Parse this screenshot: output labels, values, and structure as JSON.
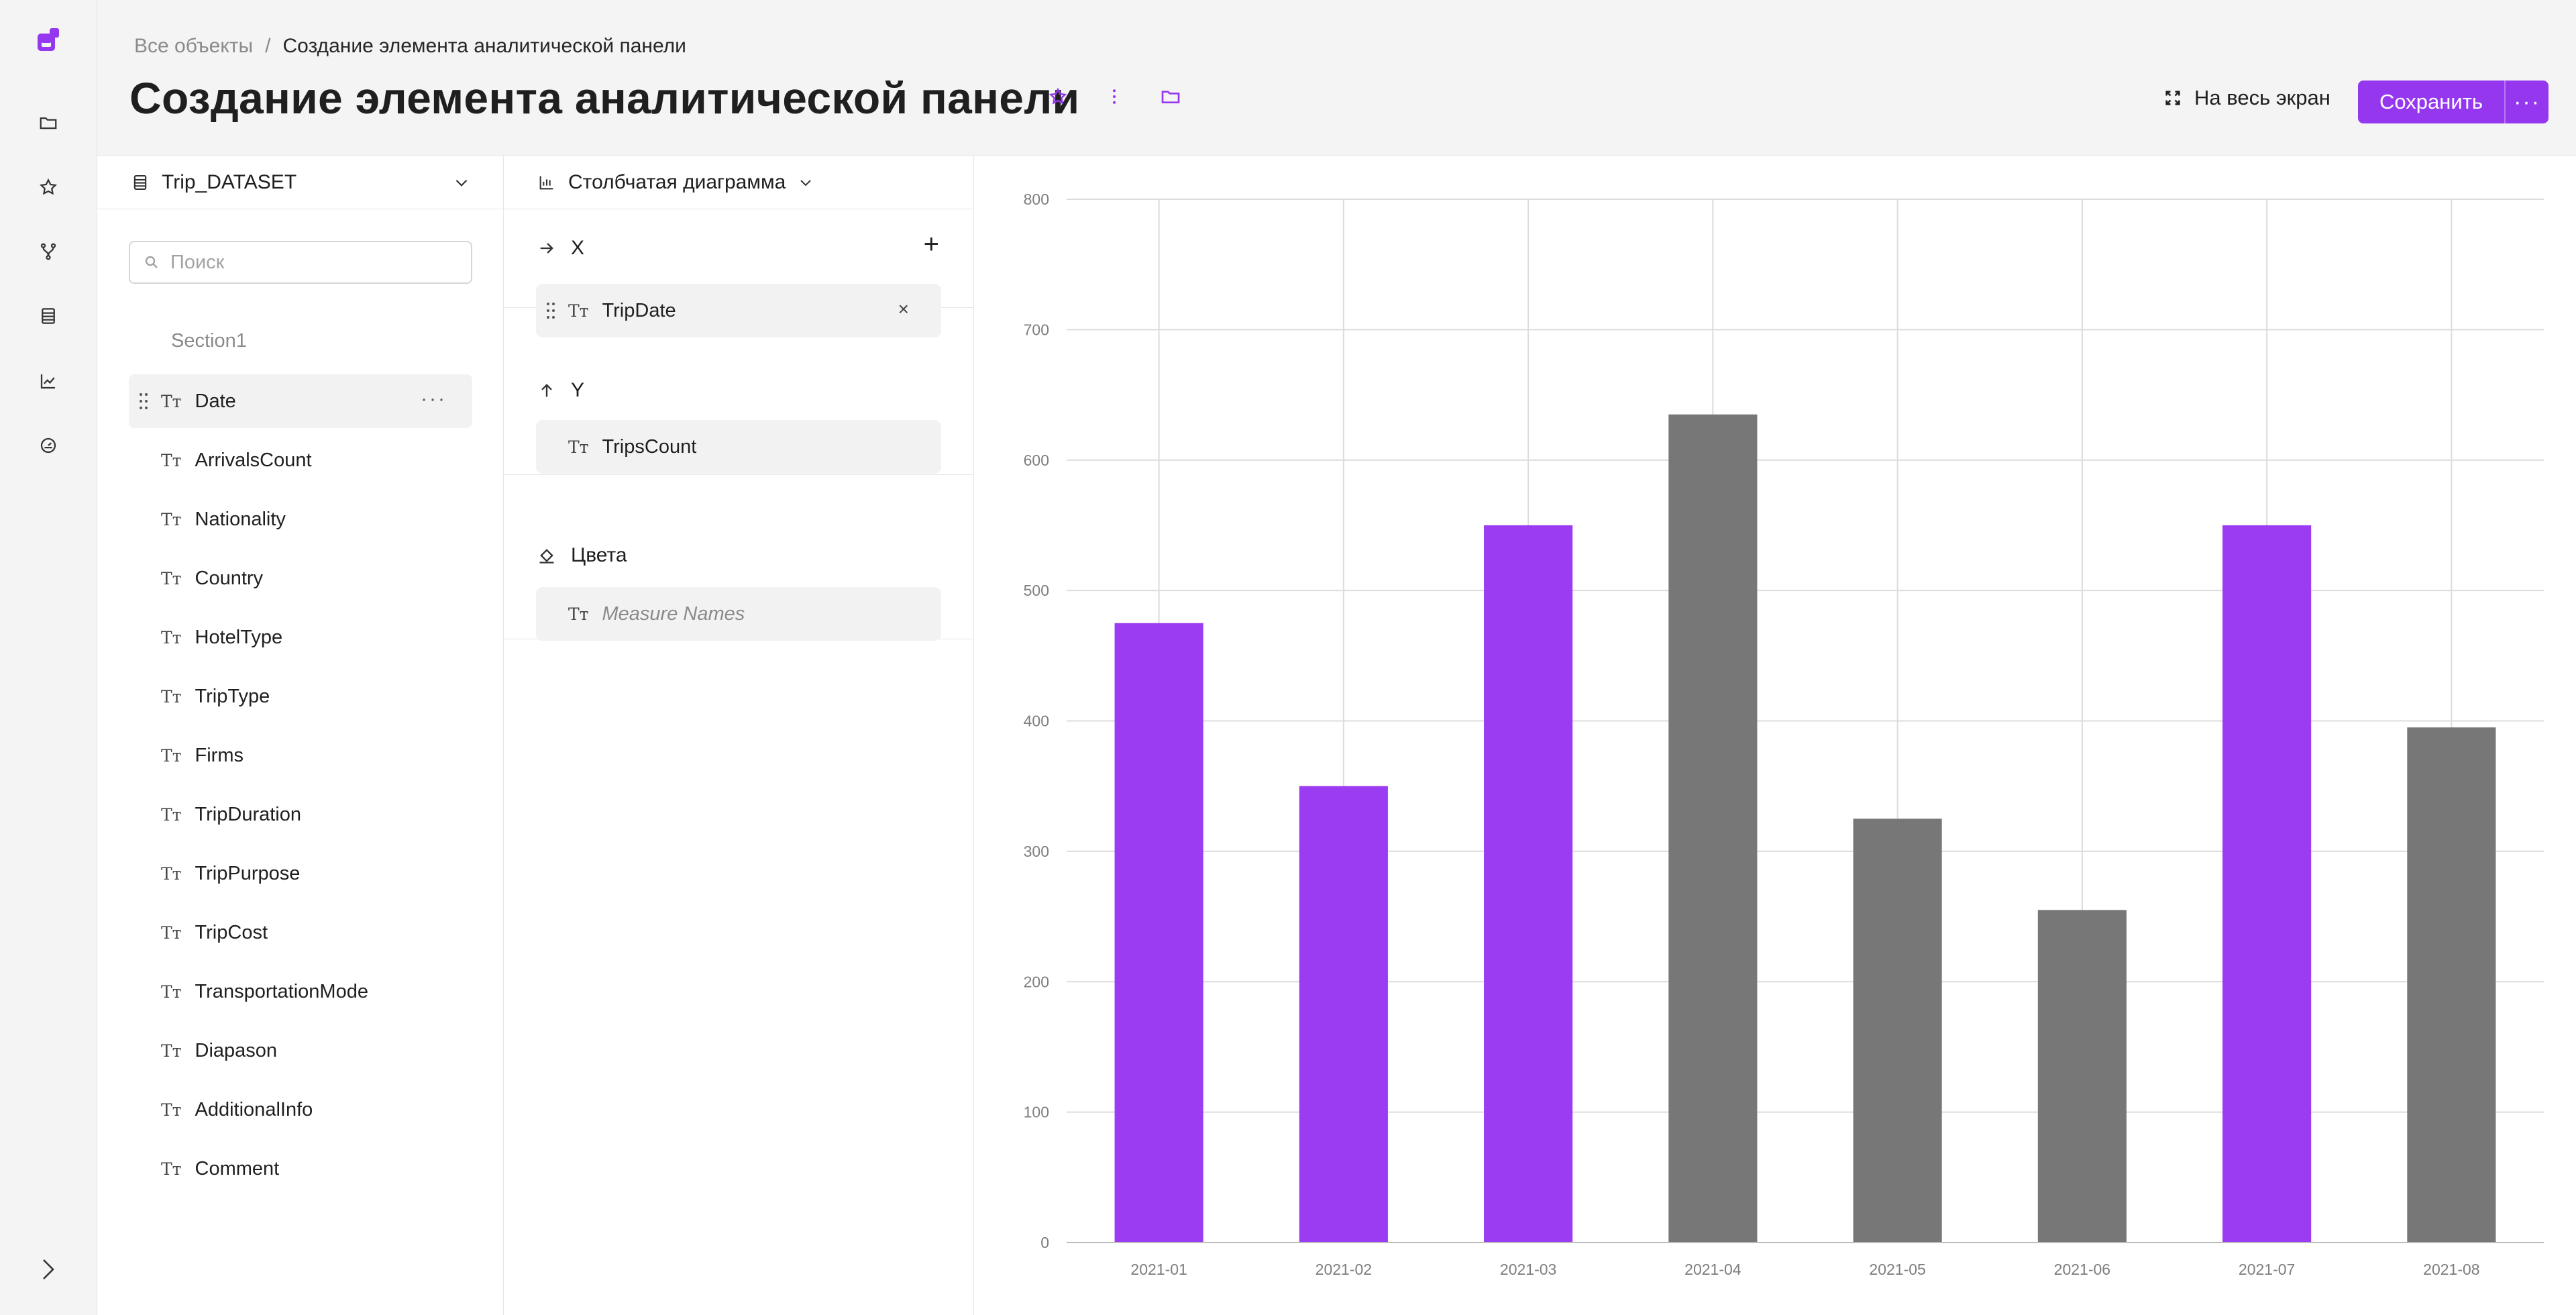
{
  "breadcrumb": {
    "root": "Все объекты",
    "separator": "/",
    "current": "Создание элемента аналитической панели"
  },
  "page_title": "Создание элемента аналитической панели",
  "header": {
    "fullscreen_label": "На весь экран",
    "save_label": "Сохранить",
    "more_label": "···"
  },
  "dataset": {
    "name": "Trip_DATASET",
    "search_placeholder": "Поиск",
    "section": "Section1",
    "fields": [
      "Date",
      "ArrivalsCount",
      "Nationality",
      "Country",
      "HotelType",
      "TripType",
      "Firms",
      "TripDuration",
      "TripPurpose",
      "TripCost",
      "TransportationMode",
      "Diapason",
      "AdditionalInfo",
      "Comment"
    ],
    "field_type_glyph": "Tт",
    "field_more": "···"
  },
  "visualization": {
    "type_label": "Столбчатая диаграмма",
    "x": {
      "label": "X",
      "add": "+",
      "field": "TripDate",
      "remove": "×"
    },
    "y": {
      "label": "Y",
      "field": "TripsCount"
    },
    "colors": {
      "label": "Цвета",
      "field": "Measure Names"
    }
  },
  "colors": {
    "accent": "#9437ef",
    "bar_purple": "#9b3cf2",
    "bar_gray": "#777777"
  },
  "chart_data": {
    "type": "bar",
    "categories": [
      "2021-01",
      "2021-02",
      "2021-03",
      "2021-04",
      "2021-05",
      "2021-06",
      "2021-07",
      "2021-08"
    ],
    "values": [
      475,
      350,
      550,
      635,
      325,
      255,
      550,
      395
    ],
    "bar_colors": [
      "purple",
      "purple",
      "purple",
      "gray",
      "gray",
      "gray",
      "purple",
      "gray"
    ],
    "ylim": [
      0,
      800
    ],
    "yticks": [
      0,
      100,
      200,
      300,
      400,
      500,
      600,
      700,
      800
    ],
    "grid": true,
    "legend": "none",
    "title": "",
    "xlabel": "",
    "ylabel": ""
  }
}
